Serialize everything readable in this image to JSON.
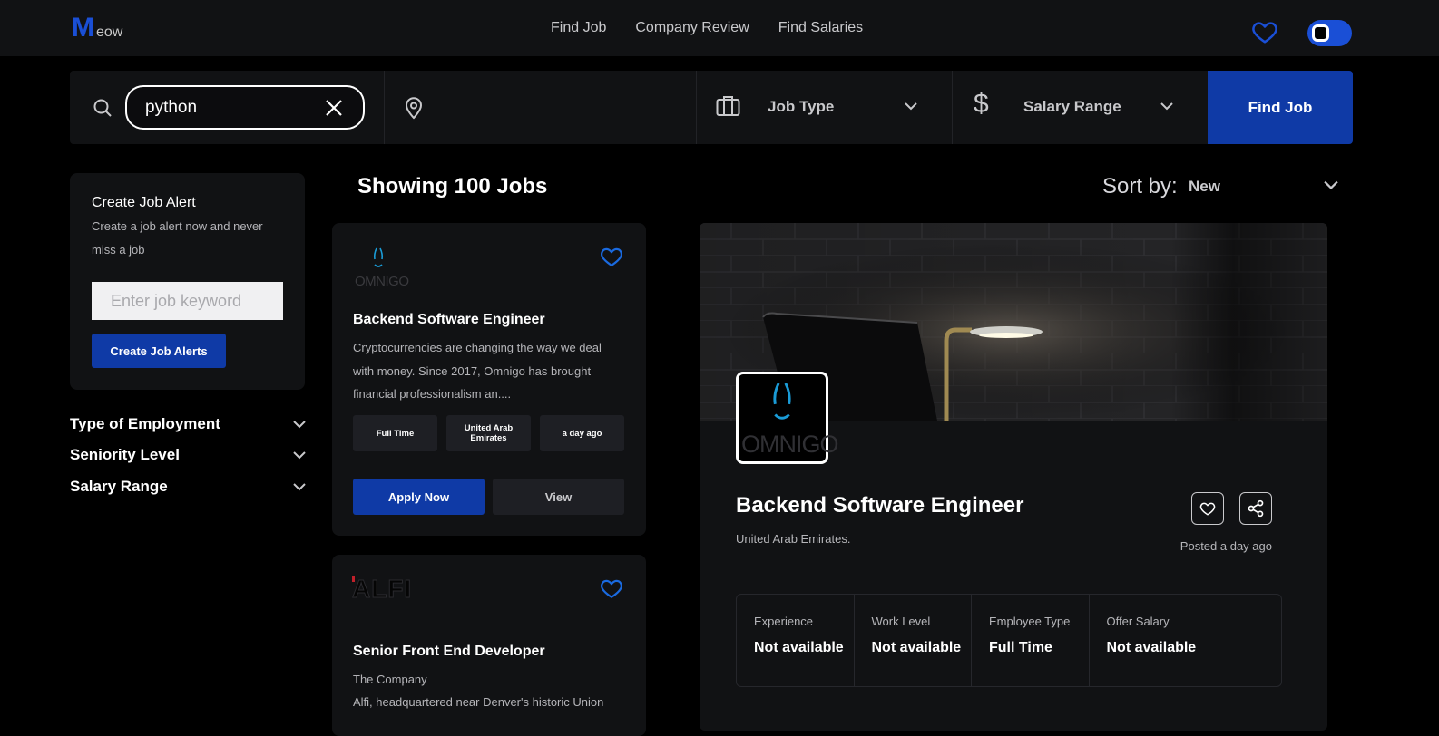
{
  "header": {
    "logo_initial": "M",
    "logo_rest": "eow",
    "nav": [
      "Find Job",
      "Company Review",
      "Find Salaries"
    ],
    "accent_color": "#1a4fd6"
  },
  "search": {
    "query": "python",
    "location_placeholder": "",
    "job_type_label": "Job Type",
    "salary_range_label": "Salary Range",
    "find_button": "Find Job"
  },
  "alert": {
    "title": "Create Job Alert",
    "description": "Create a job alert now and never miss a job",
    "input_placeholder": "Enter job keyword",
    "button": "Create Job Alerts"
  },
  "filters": [
    "Type of Employment",
    "Seniority Level",
    "Salary Range"
  ],
  "results": {
    "showing": "Showing 100 Jobs",
    "sort_label": "Sort by:",
    "sort_value": "New"
  },
  "jobs": [
    {
      "logo_text": "OMNIGO",
      "title": "Backend Software Engineer",
      "description": "Cryptocurrencies are changing the way we deal with money. Since 2017, Omnigo has brought financial professionalism an....",
      "tags": [
        "Full Time",
        "United Arab Emirates",
        "a day ago"
      ],
      "apply": "Apply Now",
      "view": "View"
    },
    {
      "logo_text": "ALFI",
      "title": "Senior Front End Developer",
      "subtitle": "The Company",
      "description": "Alfi, headquartered near Denver's historic Union"
    }
  ],
  "detail": {
    "logo_text": "OMNIGO",
    "title": "Backend Software Engineer",
    "location": "United Arab Emirates.",
    "posted": "Posted a day ago",
    "info": [
      {
        "label": "Experience",
        "value": "Not available"
      },
      {
        "label": "Work Level",
        "value": "Not available"
      },
      {
        "label": "Employee Type",
        "value": "Full Time"
      },
      {
        "label": "Offer Salary",
        "value": "Not available"
      }
    ]
  }
}
